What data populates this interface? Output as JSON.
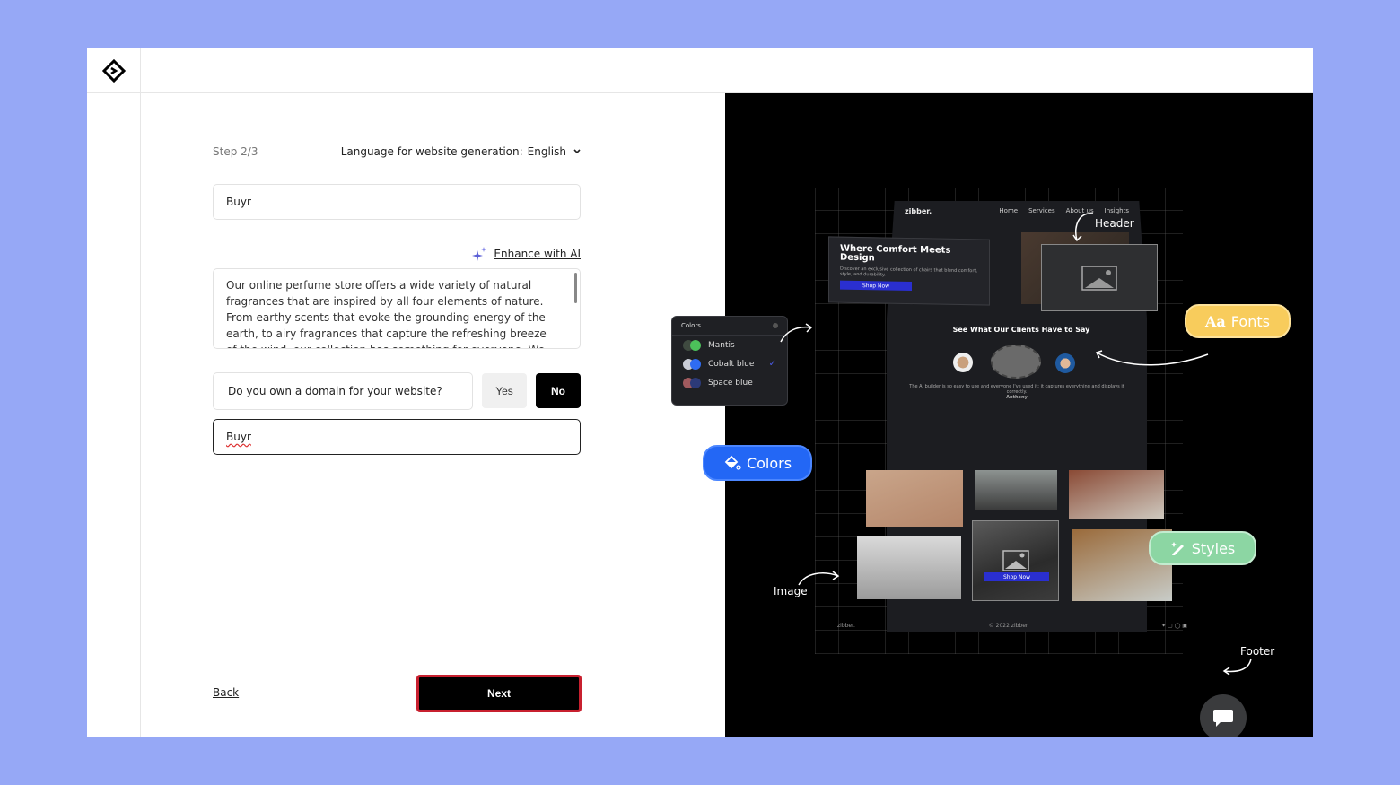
{
  "app": {
    "logo": "diamond-logo"
  },
  "form": {
    "step": "Step 2/3",
    "language_label": "Language for website generation:",
    "language_value": "English",
    "business_name": "Buyr",
    "enhance_label": "Enhance with AI",
    "description": "Our online perfume store offers a wide variety of natural fragrances that are inspired by all four elements of nature. From earthy scents that evoke the grounding energy of the earth, to airy fragrances that capture the refreshing breeze of the wind, our collection has something for everyone. We use only the finest",
    "domain_question": "Do you own a domain for your website?",
    "yes_label": "Yes",
    "no_label": "No",
    "domain_value": "Buyr",
    "back_label": "Back",
    "next_label": "Next"
  },
  "preview": {
    "mock_site": {
      "brand": "zibber.",
      "nav": [
        "Home",
        "Services",
        "About us",
        "Insights"
      ],
      "hero_title": "Where Comfort Meets Design",
      "hero_subtitle": "Discover an exclusive collection of chairs that blend comfort, style, and durability.",
      "hero_button": "Shop Now",
      "testimonials_title": "See What Our Clients Have to Say",
      "testimonial_text": "The AI builder is so easy to use and everyone I've used it; it captures everything and displays it correctly.",
      "testimonial_author": "Anthony",
      "gallery_button": "Shop Now",
      "footer_brand": "zibber.",
      "footer_copyright": "© 2022 zibber"
    },
    "colors_panel": {
      "title": "Colors",
      "options": [
        {
          "name": "Mantis",
          "colors": [
            "#3f4a40",
            "#4cc05a"
          ],
          "selected": false
        },
        {
          "name": "Cobalt blue",
          "colors": [
            "#c9ccd6",
            "#2f6cf2"
          ],
          "selected": true
        },
        {
          "name": "Space blue",
          "colors": [
            "#a05a5e",
            "#2c3a78"
          ],
          "selected": false
        }
      ]
    },
    "pills": {
      "colors": "Colors",
      "fonts": "Fonts",
      "fonts_glyph": "Aa",
      "styles": "Styles"
    },
    "annotations": {
      "header": "Header",
      "image": "Image",
      "footer": "Footer"
    },
    "accent_colors": {
      "colors_pill": "#2367f5",
      "fonts_pill": "#f8cc5c",
      "styles_pill": "#8cd6a3",
      "next_border": "#c8202f"
    }
  }
}
